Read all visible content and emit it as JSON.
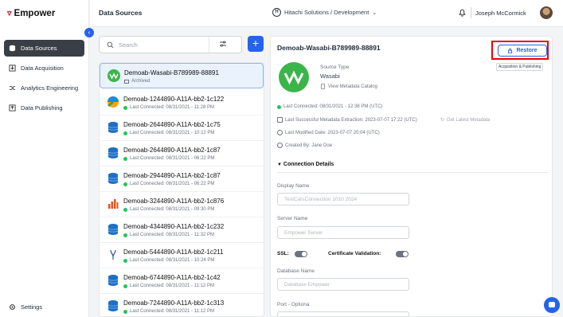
{
  "brand": {
    "name": "Empower"
  },
  "sidebar": {
    "items": [
      {
        "label": "Data Sources"
      },
      {
        "label": "Data Acquisition"
      },
      {
        "label": "Analytics Engineering"
      },
      {
        "label": "Data Publishing"
      }
    ],
    "settings_label": "Settings"
  },
  "header": {
    "title": "Data Sources",
    "org": "Hitachi Solutions / Development",
    "user": "Joseph McCormick"
  },
  "search": {
    "placeholder": "Search"
  },
  "list": {
    "items": [
      {
        "name": "Demoab-Wasabi-B789989-88891",
        "status": "Archived",
        "icon": "wasabi-icon"
      },
      {
        "name": "Demoab-1244890-A11A-bb2-1c122",
        "status": "Last Connected: 08/31/2021 - 11:28 PM",
        "icon": "cloud-icon"
      },
      {
        "name": "Demoab-2644890-A11A-bb2-1c75",
        "status": "Last Connected: 08/31/2021 - 10:12 PM",
        "icon": "database-icon"
      },
      {
        "name": "Demoab-2644890-A11A-bb2-1c87",
        "status": "Last Connected: 08/31/2021 - 06:22 PM",
        "icon": "database-icon"
      },
      {
        "name": "Demoab-2944890-A11A-bb2-1c87",
        "status": "Last Connected: 08/31/2021 - 06:22 PM",
        "icon": "database-icon"
      },
      {
        "name": "Demoab-3244890-A11A-bb2-1c876",
        "status": "Last Connected: 08/31/2021 - 09:30 PM",
        "icon": "chart-icon"
      },
      {
        "name": "Demoab-4344890-A11A-bb2-1c232",
        "status": "Last Connected: 08/31/2021 - 11:32 PM",
        "icon": "database-icon"
      },
      {
        "name": "Demoab-5444890-A11A-bb2-1c211",
        "status": "Last Connected: 08/31/2021 - 10:24 PM",
        "icon": "fork-icon"
      },
      {
        "name": "Demoab-6744890-A11A-bb2-1c42",
        "status": "Last Connected: 08/31/2021 - 11:12 PM",
        "icon": "database-icon"
      },
      {
        "name": "Demoab-7244890-A11A-bb2-1c313",
        "status": "Last Connected: 08/31/2021 - 11:12 PM",
        "icon": "database-icon"
      }
    ]
  },
  "detail": {
    "title": "Demoab-Wasabi-B789989-88891",
    "restore_label": "Restore",
    "tag": "Acquisition & Publishing",
    "source_type_label": "Source Type",
    "source_type_value": "Wasabi",
    "view_metadata": "View Metadata Catalog",
    "last_connected": "Last Connected: 08/31/2021 - 12:38 PM (UTC)",
    "last_extraction": "Last Successful Metadata Extraction: 2023-07-07 17:22 (UTC)",
    "get_latest": "Get Latest Metadata",
    "last_modified": "Last Modified Date: 2023-07-07 20:04 (UTC)",
    "created_by": "Created By: Jane Doe",
    "connection_title": "Connection Details",
    "display_name_label": "Display Name",
    "display_name_value": "TestCarsConnection 1010 2024",
    "server_name_label": "Server Name",
    "server_name_placeholder": "Empower Server",
    "ssl_label": "SSL:",
    "cert_label": "Certificate Validation:",
    "database_label": "Database Name",
    "database_placeholder": "Database Empower",
    "port_label": "Port - Optiona"
  },
  "colors": {
    "accent": "#2563eb",
    "active_nav": "#3a3f47",
    "highlight": "#ff0000",
    "status": "#22c55e"
  }
}
